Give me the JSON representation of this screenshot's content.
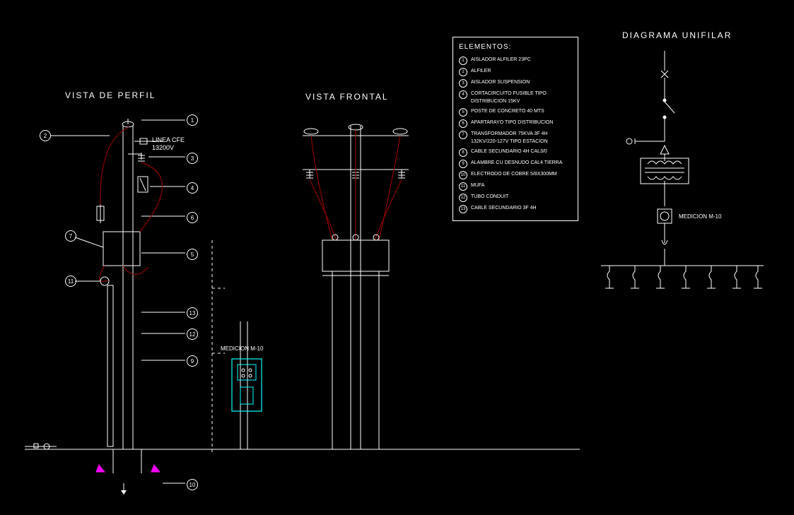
{
  "titles": {
    "perfil": "VISTA DE PERFIL",
    "frontal": "VISTA FRONTAL",
    "unifilar": "DIAGRAMA UNIFILAR",
    "elementos": "ELEMENTOS:"
  },
  "labels": {
    "lineacfe": "LINEA CFE",
    "voltage": "13200V",
    "medicion": "MEDICION M-10",
    "medicion2": "MEDICION M-10"
  },
  "callouts": {
    "c1": "1",
    "c2": "2",
    "c3": "3",
    "c4": "4",
    "c5": "5",
    "c6": "6",
    "c7": "7",
    "c9": "9",
    "c10": "10",
    "c11": "11",
    "c12": "12",
    "c13": "13"
  },
  "legend": [
    {
      "n": "1",
      "t": "AISLADOR ALFILER 23PC"
    },
    {
      "n": "2",
      "t": "ALFILER"
    },
    {
      "n": "3",
      "t": "AISLADOR SUSPENSION"
    },
    {
      "n": "4",
      "t": "CORTACIRCUITO FUSIBLE TIPO DISTRIBUCION 15KV"
    },
    {
      "n": "5",
      "t": "POSTE DE CONCRETO 40 MTS"
    },
    {
      "n": "6",
      "t": "APARTARAYO TIPO DISTRIBUCION"
    },
    {
      "n": "7",
      "t": "TRANSFORMADOR 75KVA 3F 4H 132KV/220-127V TIPO ESTACION"
    },
    {
      "n": "8",
      "t": "CABLE SECUNDARIO 4H CAL3/0"
    },
    {
      "n": "9",
      "t": "ALAMBRE CU DESNUDO CAL4 TIERRA"
    },
    {
      "n": "10",
      "t": "ELECTRODO DE COBRE 5/8X300MM"
    },
    {
      "n": "11",
      "t": "MUFA"
    },
    {
      "n": "12",
      "t": "TUBO CONDUIT"
    },
    {
      "n": "13",
      "t": "CABLE SECUNDARIO 3F 4H"
    }
  ]
}
